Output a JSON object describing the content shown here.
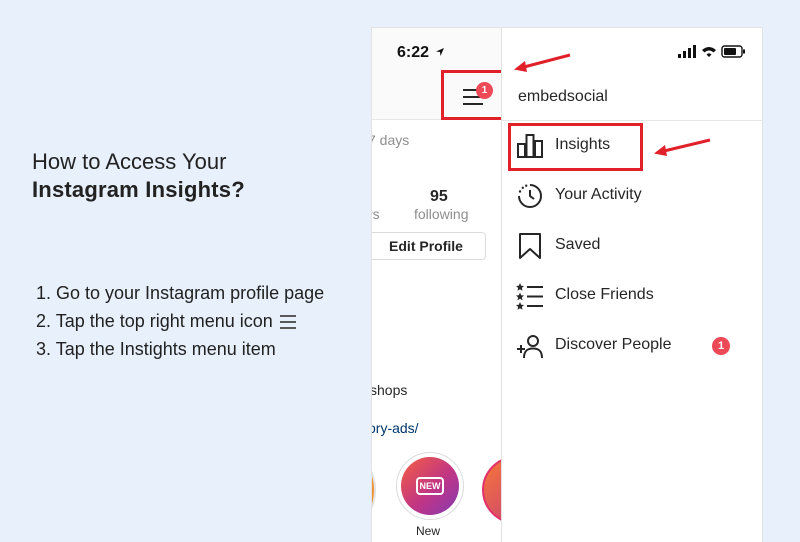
{
  "tutorial": {
    "headline_line1": "How to Access Your",
    "headline_line2": "Instagram Insights?",
    "steps": [
      "1. Go to your Instagram profile page",
      "2. Tap the top right menu icon",
      "3. Tap the Instights menu item"
    ]
  },
  "status_bar": {
    "time": "6:22"
  },
  "profile_background": {
    "days_text": "7 days",
    "following_count": "95",
    "following_label": "following",
    "followers_label_partial": "rs",
    "edit_profile_label": "Edit Profile",
    "bio_text": "shops",
    "bio_link": "ory-ads/",
    "highlight_new_label": "New",
    "highlight_new_glyph": "NEW"
  },
  "menu_button": {
    "badge_count": "1"
  },
  "side_menu": {
    "username": "embedsocial",
    "items": [
      {
        "label": "Insights",
        "icon": "bar-chart-icon"
      },
      {
        "label": "Your Activity",
        "icon": "activity-clock-icon"
      },
      {
        "label": "Saved",
        "icon": "bookmark-icon"
      },
      {
        "label": "Close Friends",
        "icon": "close-friends-list-icon"
      },
      {
        "label": "Discover People",
        "icon": "add-person-icon",
        "badge": "1"
      }
    ]
  },
  "colors": {
    "page_background": "#e7f0fb",
    "highlight_box": "#e0212a",
    "badge": "#ed4956",
    "link": "#00376b"
  }
}
